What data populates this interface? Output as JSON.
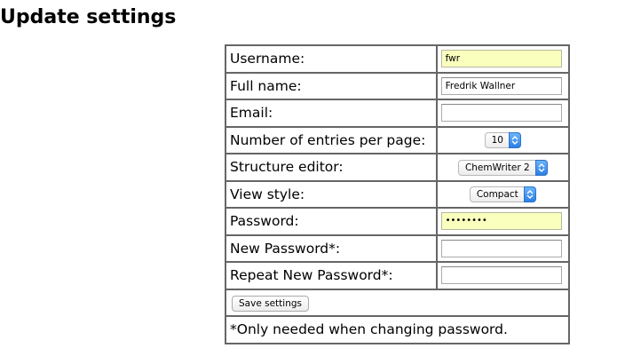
{
  "page": {
    "title": "Update settings"
  },
  "form": {
    "rows": [
      {
        "label": "Username:",
        "type": "text",
        "value": "fwr",
        "autofill": true
      },
      {
        "label": "Full name:",
        "type": "text",
        "value": "Fredrik Wallner"
      },
      {
        "label": "Email:",
        "type": "text",
        "value": ""
      },
      {
        "label": "Number of entries per page:",
        "type": "select",
        "value": "10"
      },
      {
        "label": "Structure editor:",
        "type": "select",
        "value": "ChemWriter 2"
      },
      {
        "label": "View style:",
        "type": "select",
        "value": "Compact"
      },
      {
        "label": "Password:",
        "type": "password",
        "value": "••••••••",
        "autofill": true
      },
      {
        "label": "New Password*:",
        "type": "password",
        "value": ""
      },
      {
        "label": "Repeat New Password*:",
        "type": "password",
        "value": ""
      }
    ],
    "save_label": "Save settings",
    "note": "*Only needed when changing password."
  },
  "colors": {
    "autofill_bg": "#faffbd",
    "select_accent": "#2a7fe6",
    "border": "#666666"
  }
}
